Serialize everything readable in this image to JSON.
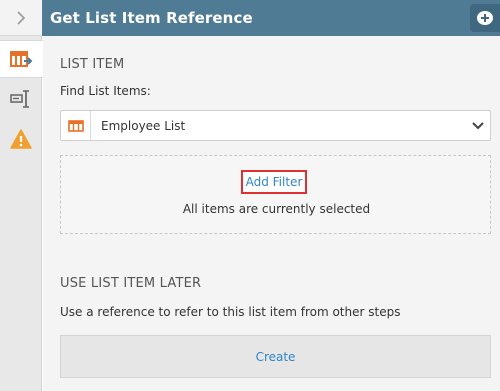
{
  "header": {
    "title": "Get List Item Reference"
  },
  "rail": {
    "items": [
      {
        "icon": "list-item-reference-icon"
      },
      {
        "icon": "text-field-icon"
      },
      {
        "icon": "warning-icon"
      }
    ]
  },
  "list_item": {
    "section_title": "LIST ITEM",
    "find_label": "Find List Items:",
    "selected_list": "Employee List",
    "add_filter_label": "Add Filter",
    "filter_status": "All items are currently selected"
  },
  "use_later": {
    "section_title": "USE LIST ITEM LATER",
    "description": "Use a reference to refer to this list item from other steps",
    "create_label": "Create"
  },
  "colors": {
    "header_bg": "#4f7b94",
    "link": "#2f86c8",
    "highlight_border": "#e03131",
    "list_icon": "#e8712a",
    "warning": "#f0a030"
  }
}
